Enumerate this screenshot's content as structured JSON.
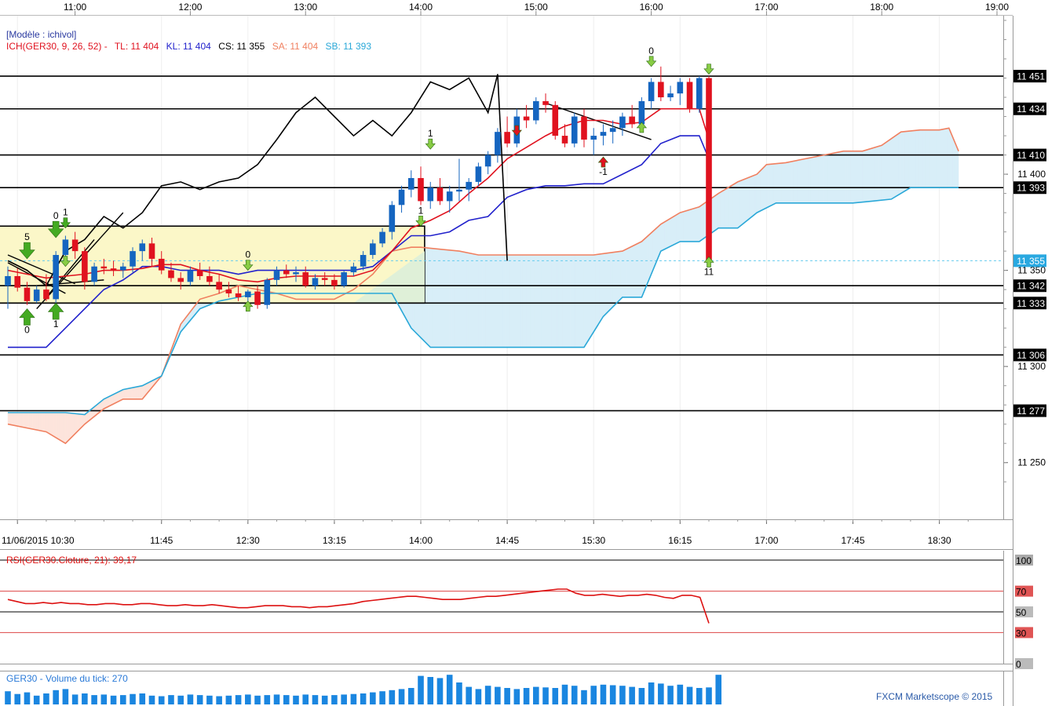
{
  "top_axis": {
    "times": [
      "11:00",
      "12:00",
      "13:00",
      "14:00",
      "15:00",
      "16:00",
      "17:00",
      "18:00",
      "19:00"
    ]
  },
  "legend": {
    "model_label": "[Modèle : ichivol]",
    "ich_label": "ICH(GER30, 9, 26, 52) -",
    "tl_label": "TL: 11 404",
    "kl_label": "KL: 11 404",
    "cs_label": "CS: 11 355",
    "sa_label": "SA: 11 404",
    "sb_label": "SB: 11 393"
  },
  "colors": {
    "bull": "#1565c0",
    "bear": "#e0121f",
    "tenkan": "#e0121f",
    "kijun": "#2222cc",
    "chikou": "#000000",
    "senkou_a": "#f08060",
    "senkou_b": "#2aa8d8",
    "cloud_bull": "#d8eef8",
    "cloud_bear": "#fde4dc",
    "range_box": "#fbf7c8",
    "rsi": "#dd1111",
    "volume": "#1a86e0",
    "signal_up": "#44aa22"
  },
  "price_scale": {
    "ticks": [
      "11 400",
      "11 350",
      "11 300",
      "11 250"
    ]
  },
  "price_tags": [
    "11 451",
    "11 434",
    "11 410",
    "11 393",
    "11 355",
    "11 342",
    "11 333",
    "11 306",
    "11 277"
  ],
  "bottom_axis": {
    "labels": [
      "11/06/2015 10:30",
      "11:45",
      "12:30",
      "13:15",
      "14:00",
      "14:45",
      "15:30",
      "16:15",
      "17:00",
      "17:45",
      "18:30"
    ]
  },
  "signals": {
    "labels": [
      "0",
      "1",
      "5",
      "0",
      "1",
      "0",
      "1",
      "1",
      "0",
      "-1",
      "11"
    ]
  },
  "rsi": {
    "title": "RSI(GER30.Cloture, 21): 39,17",
    "levels": [
      "100",
      "70",
      "50",
      "30",
      "0"
    ]
  },
  "volume": {
    "title": "GER30 - Volume du tick: 270"
  },
  "copyright": "FXCM Marketscope © 2015",
  "chart_data": {
    "type": "candlestick",
    "instrument": "GER30",
    "date": "11/06/2015",
    "x_range": [
      "10:25",
      "19:00"
    ],
    "ylim": [
      11225,
      11480
    ],
    "horizontal_levels": [
      11451,
      11434,
      11410,
      11393,
      11342,
      11333,
      11306,
      11277
    ],
    "current_price": 11355,
    "candles": [
      {
        "t": "10:25",
        "o": 11342,
        "h": 11352,
        "l": 11330,
        "c": 11347
      },
      {
        "t": "10:30",
        "o": 11347,
        "h": 11351,
        "l": 11339,
        "c": 11341
      },
      {
        "t": "10:35",
        "o": 11341,
        "h": 11344,
        "l": 11332,
        "c": 11334
      },
      {
        "t": "10:40",
        "o": 11334,
        "h": 11342,
        "l": 11333,
        "c": 11340
      },
      {
        "t": "10:45",
        "o": 11340,
        "h": 11348,
        "l": 11334,
        "c": 11335
      },
      {
        "t": "10:50",
        "o": 11335,
        "h": 11360,
        "l": 11333,
        "c": 11358
      },
      {
        "t": "10:55",
        "o": 11358,
        "h": 11368,
        "l": 11355,
        "c": 11366
      },
      {
        "t": "11:00",
        "o": 11366,
        "h": 11370,
        "l": 11356,
        "c": 11360
      },
      {
        "t": "11:05",
        "o": 11360,
        "h": 11362,
        "l": 11340,
        "c": 11344
      },
      {
        "t": "11:10",
        "o": 11344,
        "h": 11354,
        "l": 11342,
        "c": 11352
      },
      {
        "t": "11:15",
        "o": 11352,
        "h": 11356,
        "l": 11348,
        "c": 11351
      },
      {
        "t": "11:20",
        "o": 11351,
        "h": 11355,
        "l": 11347,
        "c": 11350
      },
      {
        "t": "11:25",
        "o": 11350,
        "h": 11354,
        "l": 11346,
        "c": 11352
      },
      {
        "t": "11:30",
        "o": 11352,
        "h": 11362,
        "l": 11349,
        "c": 11360
      },
      {
        "t": "11:35",
        "o": 11360,
        "h": 11366,
        "l": 11355,
        "c": 11364
      },
      {
        "t": "11:40",
        "o": 11364,
        "h": 11367,
        "l": 11352,
        "c": 11356
      },
      {
        "t": "11:45",
        "o": 11356,
        "h": 11360,
        "l": 11348,
        "c": 11350
      },
      {
        "t": "11:50",
        "o": 11350,
        "h": 11354,
        "l": 11344,
        "c": 11346
      },
      {
        "t": "11:55",
        "o": 11346,
        "h": 11349,
        "l": 11340,
        "c": 11344
      },
      {
        "t": "12:00",
        "o": 11344,
        "h": 11352,
        "l": 11342,
        "c": 11350
      },
      {
        "t": "12:05",
        "o": 11350,
        "h": 11354,
        "l": 11345,
        "c": 11347
      },
      {
        "t": "12:10",
        "o": 11347,
        "h": 11352,
        "l": 11342,
        "c": 11344
      },
      {
        "t": "12:15",
        "o": 11344,
        "h": 11348,
        "l": 11338,
        "c": 11340
      },
      {
        "t": "12:20",
        "o": 11340,
        "h": 11344,
        "l": 11336,
        "c": 11338
      },
      {
        "t": "12:25",
        "o": 11338,
        "h": 11342,
        "l": 11334,
        "c": 11336
      },
      {
        "t": "12:30",
        "o": 11336,
        "h": 11340,
        "l": 11330,
        "c": 11339
      },
      {
        "t": "12:35",
        "o": 11339,
        "h": 11342,
        "l": 11330,
        "c": 11332
      },
      {
        "t": "12:40",
        "o": 11332,
        "h": 11346,
        "l": 11330,
        "c": 11345
      },
      {
        "t": "12:45",
        "o": 11345,
        "h": 11352,
        "l": 11342,
        "c": 11350
      },
      {
        "t": "12:50",
        "o": 11350,
        "h": 11353,
        "l": 11346,
        "c": 11348
      },
      {
        "t": "12:55",
        "o": 11348,
        "h": 11352,
        "l": 11344,
        "c": 11349
      },
      {
        "t": "13:00",
        "o": 11349,
        "h": 11352,
        "l": 11341,
        "c": 11342
      },
      {
        "t": "13:05",
        "o": 11342,
        "h": 11348,
        "l": 11340,
        "c": 11346
      },
      {
        "t": "13:10",
        "o": 11346,
        "h": 11349,
        "l": 11342,
        "c": 11345
      },
      {
        "t": "13:15",
        "o": 11345,
        "h": 11348,
        "l": 11340,
        "c": 11342
      },
      {
        "t": "13:20",
        "o": 11342,
        "h": 11350,
        "l": 11341,
        "c": 11349
      },
      {
        "t": "13:25",
        "o": 11349,
        "h": 11354,
        "l": 11347,
        "c": 11352
      },
      {
        "t": "13:30",
        "o": 11352,
        "h": 11360,
        "l": 11350,
        "c": 11358
      },
      {
        "t": "13:35",
        "o": 11358,
        "h": 11366,
        "l": 11356,
        "c": 11364
      },
      {
        "t": "13:40",
        "o": 11364,
        "h": 11372,
        "l": 11362,
        "c": 11370
      },
      {
        "t": "13:45",
        "o": 11370,
        "h": 11386,
        "l": 11366,
        "c": 11384
      },
      {
        "t": "13:50",
        "o": 11384,
        "h": 11394,
        "l": 11380,
        "c": 11392
      },
      {
        "t": "13:55",
        "o": 11392,
        "h": 11402,
        "l": 11388,
        "c": 11398
      },
      {
        "t": "14:00",
        "o": 11398,
        "h": 11404,
        "l": 11384,
        "c": 11386
      },
      {
        "t": "14:05",
        "o": 11386,
        "h": 11396,
        "l": 11382,
        "c": 11393
      },
      {
        "t": "14:10",
        "o": 11393,
        "h": 11398,
        "l": 11384,
        "c": 11386
      },
      {
        "t": "14:15",
        "o": 11386,
        "h": 11394,
        "l": 11380,
        "c": 11391
      },
      {
        "t": "14:20",
        "o": 11391,
        "h": 11408,
        "l": 11386,
        "c": 11392
      },
      {
        "t": "14:25",
        "o": 11392,
        "h": 11398,
        "l": 11386,
        "c": 11396
      },
      {
        "t": "14:30",
        "o": 11396,
        "h": 11406,
        "l": 11394,
        "c": 11404
      },
      {
        "t": "14:35",
        "o": 11404,
        "h": 11412,
        "l": 11400,
        "c": 11410
      },
      {
        "t": "14:40",
        "o": 11410,
        "h": 11424,
        "l": 11406,
        "c": 11422
      },
      {
        "t": "14:45",
        "o": 11422,
        "h": 11430,
        "l": 11414,
        "c": 11416
      },
      {
        "t": "14:50",
        "o": 11416,
        "h": 11434,
        "l": 11414,
        "c": 11430
      },
      {
        "t": "14:55",
        "o": 11430,
        "h": 11436,
        "l": 11424,
        "c": 11428
      },
      {
        "t": "15:00",
        "o": 11428,
        "h": 11440,
        "l": 11426,
        "c": 11438
      },
      {
        "t": "15:05",
        "o": 11438,
        "h": 11442,
        "l": 11432,
        "c": 11436
      },
      {
        "t": "15:10",
        "o": 11436,
        "h": 11438,
        "l": 11418,
        "c": 11420
      },
      {
        "t": "15:15",
        "o": 11420,
        "h": 11426,
        "l": 11414,
        "c": 11416
      },
      {
        "t": "15:20",
        "o": 11416,
        "h": 11432,
        "l": 11414,
        "c": 11430
      },
      {
        "t": "15:25",
        "o": 11430,
        "h": 11434,
        "l": 11414,
        "c": 11418
      },
      {
        "t": "15:30",
        "o": 11418,
        "h": 11424,
        "l": 11410,
        "c": 11420
      },
      {
        "t": "15:35",
        "o": 11420,
        "h": 11426,
        "l": 11415,
        "c": 11422
      },
      {
        "t": "15:40",
        "o": 11422,
        "h": 11428,
        "l": 11416,
        "c": 11424
      },
      {
        "t": "15:45",
        "o": 11424,
        "h": 11432,
        "l": 11420,
        "c": 11430
      },
      {
        "t": "15:50",
        "o": 11430,
        "h": 11436,
        "l": 11424,
        "c": 11426
      },
      {
        "t": "15:55",
        "o": 11426,
        "h": 11440,
        "l": 11424,
        "c": 11438
      },
      {
        "t": "16:00",
        "o": 11438,
        "h": 11450,
        "l": 11434,
        "c": 11448
      },
      {
        "t": "16:05",
        "o": 11448,
        "h": 11456,
        "l": 11438,
        "c": 11440
      },
      {
        "t": "16:10",
        "o": 11440,
        "h": 11446,
        "l": 11438,
        "c": 11442
      },
      {
        "t": "16:15",
        "o": 11442,
        "h": 11450,
        "l": 11436,
        "c": 11448
      },
      {
        "t": "16:20",
        "o": 11448,
        "h": 11450,
        "l": 11432,
        "c": 11434
      },
      {
        "t": "16:25",
        "o": 11434,
        "h": 11451,
        "l": 11432,
        "c": 11450
      },
      {
        "t": "16:30",
        "o": 11450,
        "h": 11451,
        "l": 11355,
        "c": 11355
      }
    ],
    "volume_values": [
      120,
      95,
      110,
      80,
      100,
      130,
      140,
      90,
      100,
      85,
      90,
      80,
      85,
      95,
      100,
      80,
      75,
      85,
      80,
      90,
      85,
      80,
      75,
      80,
      85,
      90,
      80,
      85,
      90,
      85,
      80,
      90,
      85,
      80,
      85,
      90,
      95,
      100,
      110,
      120,
      130,
      140,
      150,
      260,
      250,
      240,
      270,
      200,
      160,
      140,
      170,
      160,
      150,
      140,
      150,
      160,
      155,
      150,
      180,
      170,
      130,
      170,
      180,
      175,
      170,
      160,
      150,
      200,
      190,
      170,
      180,
      160,
      150,
      155,
      270
    ],
    "rsi_values": [
      62,
      60,
      58,
      58,
      59,
      58,
      59,
      58,
      58,
      57,
      57,
      58,
      58,
      57,
      57,
      58,
      58,
      57,
      56,
      56,
      57,
      56,
      56,
      57,
      56,
      55,
      54,
      54,
      55,
      56,
      56,
      56,
      55,
      55,
      54,
      55,
      55,
      56,
      57,
      58,
      60,
      61,
      62,
      63,
      64,
      65,
      65,
      64,
      63,
      62,
      62,
      62,
      63,
      64,
      65,
      65,
      66,
      67,
      68,
      69,
      70,
      71,
      72,
      72,
      68,
      66,
      66,
      67,
      66,
      65,
      66,
      66,
      67,
      66,
      64,
      63,
      66,
      66,
      64,
      39
    ]
  }
}
